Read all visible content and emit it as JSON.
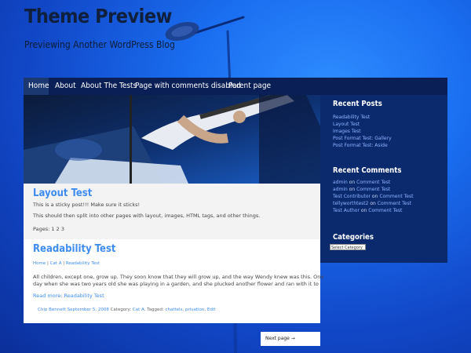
{
  "header": {
    "site_title": "Theme Preview",
    "site_description": "Previewing Another WordPress Blog"
  },
  "nav": {
    "items": [
      {
        "label": "Home",
        "active": true
      },
      {
        "label": "About"
      },
      {
        "label": "About The Tests"
      },
      {
        "label": "Page with comments disabled"
      },
      {
        "label": "Parent page"
      }
    ]
  },
  "sidebar": {
    "recent_posts": {
      "title": "Recent Posts",
      "items": [
        "Readability Test",
        "Layout Test",
        "Images Test",
        "Post Format Test: Gallery",
        "Post Format Test: Aside"
      ]
    },
    "recent_comments": {
      "title": "Recent Comments",
      "items": [
        {
          "author": "admin",
          "on": "on",
          "post": "Comment Test"
        },
        {
          "author": "admin",
          "on": "on",
          "post": "Comment Test"
        },
        {
          "author": "Test Contributor",
          "on": "on",
          "post": "Comment Test"
        },
        {
          "author": "tellyworthtest2",
          "on": "on",
          "post": "Comment Test"
        },
        {
          "author": "Test Author",
          "on": "on",
          "post": "Comment Test"
        }
      ]
    },
    "categories": {
      "title": "Categories",
      "select_value": "Select Category"
    }
  },
  "posts": [
    {
      "title": "Layout Test",
      "lines": [
        "This is a sticky post!!! Make sure it sticks!",
        "This should then split into other pages with layout, images, HTML tags, and other things."
      ],
      "pages_label": "Pages:",
      "pages": [
        "1",
        "2",
        "3"
      ]
    },
    {
      "title": "Readability Test",
      "breadcrumb": [
        "Home",
        "Cat A",
        "Readability Test"
      ],
      "excerpt_lines": [
        "All children, except one, grow up. They soon know that they will grow up, and the way Wendy knew was this. One",
        "day when she was two years old she was playing in a garden, and she plucked another flower and ran with it to"
      ],
      "read_more": "Read more: Readability Test",
      "meta": {
        "author": "Chip Bennett",
        "date": "September 5, 2008",
        "category_label": "Category:",
        "category": "Cat A",
        "tagged_label": ". Tagged:",
        "tags": [
          "chattels",
          "privation"
        ],
        "edit": "Edit"
      }
    }
  ],
  "pagination": {
    "next": "Next page →"
  },
  "colors": {
    "accent": "#3e8cf0",
    "nav_bg": "#0a1f55",
    "sidebar_bg": "#0b2a6e"
  }
}
